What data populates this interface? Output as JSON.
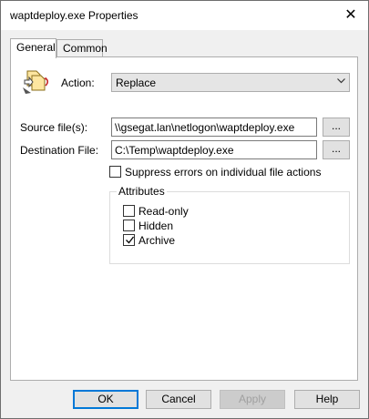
{
  "window": {
    "title": "waptdeploy.exe Properties",
    "close_glyph": "✕"
  },
  "tabs": [
    {
      "label": "General"
    },
    {
      "label": "Common"
    }
  ],
  "general": {
    "icon": "replace-file-icon",
    "action_label": "Action:",
    "action_value": "Replace",
    "source_label": "Source file(s):",
    "source_value": "\\\\gsegat.lan\\netlogon\\waptdeploy.exe",
    "dest_label": "Destination File:",
    "dest_value": "C:\\Temp\\waptdeploy.exe",
    "browse_label": "...",
    "suppress_label": "Suppress errors on individual file actions",
    "suppress_checked": false,
    "attributes_title": "Attributes",
    "attributes": [
      {
        "label": "Read-only",
        "checked": false
      },
      {
        "label": "Hidden",
        "checked": false
      },
      {
        "label": "Archive",
        "checked": true
      }
    ]
  },
  "buttons": {
    "ok": "OK",
    "cancel": "Cancel",
    "apply": "Apply",
    "help": "Help"
  }
}
